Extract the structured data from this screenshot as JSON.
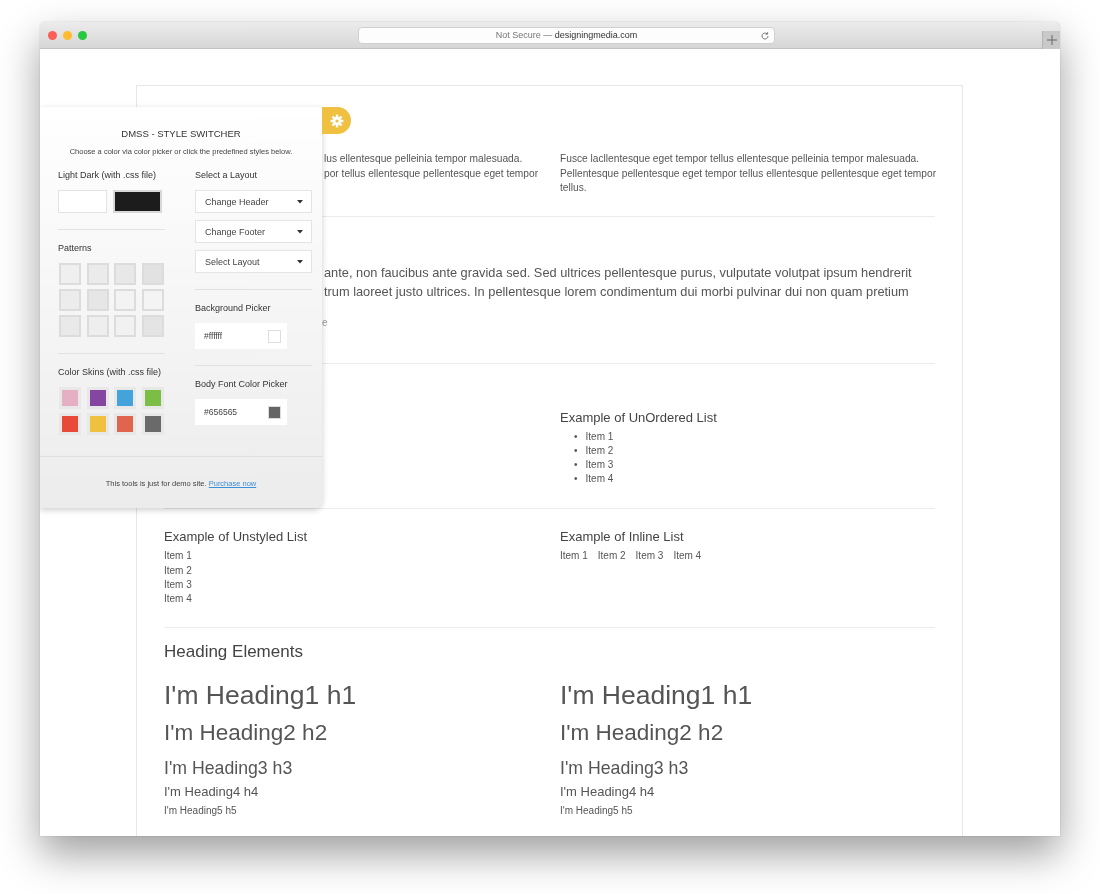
{
  "browser": {
    "security_label": "Not Secure —",
    "domain": "designingmedia.com"
  },
  "content": {
    "intro": {
      "left_lines": [
        "lus ellentesque pelleinia tempor malesuada.",
        "por tellus ellentesque pellentesque eget tempor"
      ],
      "right_text": "Fusce lacllentesque eget tempor tellus ellentesque pelleinia tempor malesuada. Pellentesque pellentesque eget tempor tellus ellentesque pellentesque eget tempor tellus."
    },
    "lead": {
      "lines": [
        "ante, non faucibus ante gravida sed. Sed ultrices pellentesque purus, vulputate volutpat ipsum hendrerit",
        "trum laoreet justo ultrices. In pellentesque lorem condimentum dui morbi pulvinar dui non quam pretium"
      ],
      "cite": "e"
    },
    "unordered_list": {
      "title": "Example of UnOrdered List",
      "items": [
        {
          "marker": "•",
          "text": "Item 1"
        },
        {
          "marker": "•",
          "text": "Item 2"
        },
        {
          "marker": "•",
          "text": "Item 3"
        },
        {
          "marker": "•",
          "text": "Item 4"
        }
      ]
    },
    "unstyled_list": {
      "title": "Example of Unstyled List",
      "items": [
        "Item 1",
        "Item 2",
        "Item 3",
        "Item 4"
      ]
    },
    "inline_list": {
      "title": "Example of Inline List",
      "items": [
        "Item 1",
        "Item 2",
        "Item 3",
        "Item 4"
      ]
    },
    "headings": {
      "title": "Heading Elements",
      "columns": [
        [
          {
            "kind": "h1",
            "text": "I'm Heading1 h1"
          },
          {
            "kind": "h2",
            "text": "I'm Heading2 h2"
          },
          {
            "kind": "h3",
            "text": "I'm Heading3 h3"
          },
          {
            "kind": "h4",
            "text": "I'm Heading4 h4"
          },
          {
            "kind": "h5",
            "text": "I'm Heading5 h5"
          }
        ],
        [
          {
            "kind": "h1",
            "text": "I'm Heading1 h1"
          },
          {
            "kind": "h2",
            "text": "I'm Heading2 h2"
          },
          {
            "kind": "h3",
            "text": "I'm Heading3 h3"
          },
          {
            "kind": "h4",
            "text": "I'm Heading4 h4"
          },
          {
            "kind": "h5",
            "text": "I'm Heading5 h5"
          }
        ]
      ]
    }
  },
  "style_switcher": {
    "title": "DMSS - STYLE SWITCHER",
    "subtitle": "Choose a color via color picker or click the predefined styles below.",
    "light_dark": {
      "label": "Light Dark (with .css file)",
      "options": [
        {
          "color": "#ffffff"
        },
        {
          "color": "#1c1c1c"
        }
      ]
    },
    "patterns": {
      "label": "Patterns"
    },
    "color_skins": {
      "label": "Color Skins (with .css file)",
      "options": [
        {
          "color": "#e5afc4"
        },
        {
          "color": "#8446a0"
        },
        {
          "color": "#45a3dc"
        },
        {
          "color": "#7bbd45"
        },
        {
          "color": "#e84a3a"
        },
        {
          "color": "#f0c040"
        },
        {
          "color": "#e0654f"
        },
        {
          "color": "#6a6a6a"
        }
      ]
    },
    "layout": {
      "label": "Select a Layout",
      "dropdowns": [
        "Change Header",
        "Change Footer",
        "Select Layout"
      ]
    },
    "pickers": [
      {
        "label": "Background Picker",
        "value": "#ffffff",
        "color": "#ffffff"
      },
      {
        "label": "Body Font Color Picker",
        "value": "#656565",
        "color": "#656565"
      }
    ],
    "footer": {
      "text": "This tools is just for demo site.",
      "link": "Purchase now"
    }
  }
}
